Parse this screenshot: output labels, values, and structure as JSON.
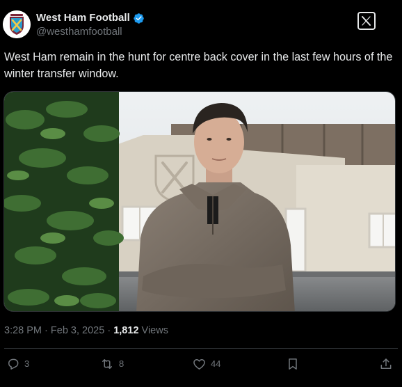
{
  "account": {
    "display_name": "West Ham Football",
    "handle": "@westhamfootball",
    "verified": true,
    "avatar_label": "WEST HAM",
    "colors": {
      "claret": "#7a263a",
      "blue": "#1bb1e7",
      "verified": "#1d9bf0"
    }
  },
  "brand": {
    "logo_icon": "x-logo-icon"
  },
  "post": {
    "text": "West Ham remain in the hunt for centre back cover in the last few hours of the winter transfer window.",
    "time": "3:28 PM",
    "date": "Feb 3, 2025",
    "views_count": "1,812",
    "views_label": "Views",
    "separator": "·"
  },
  "actions": {
    "reply": {
      "icon": "reply-icon",
      "count": "3"
    },
    "repost": {
      "icon": "repost-icon",
      "count": "8"
    },
    "like": {
      "icon": "heart-icon",
      "count": "44"
    },
    "bookmark": {
      "icon": "bookmark-icon"
    },
    "share": {
      "icon": "share-icon"
    }
  },
  "theme": {
    "background": "#000000",
    "text_primary": "#e7e9ea",
    "text_secondary": "#71767b",
    "border": "#2f3336"
  }
}
